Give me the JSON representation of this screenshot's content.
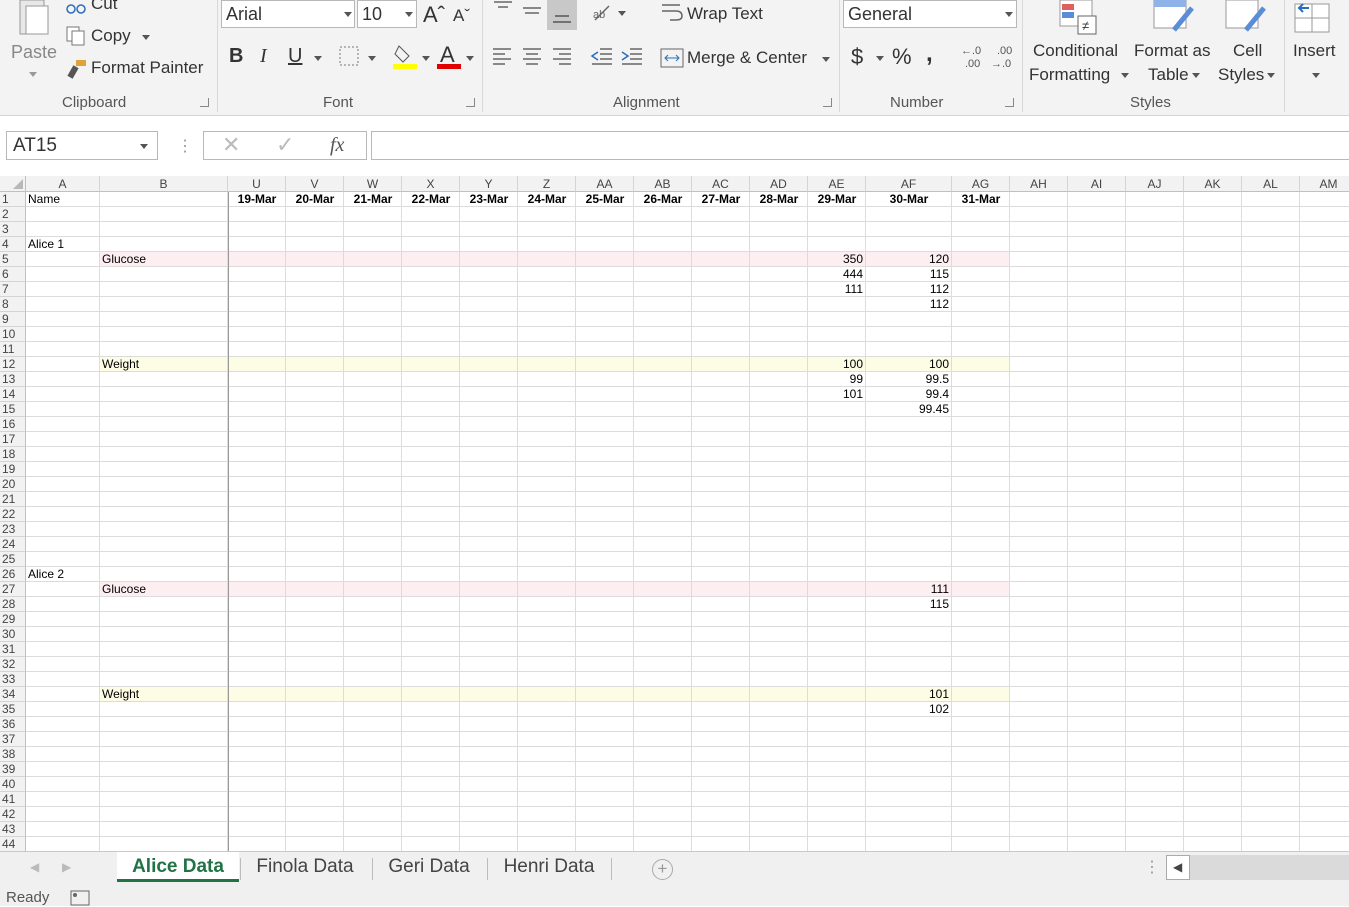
{
  "ribbon": {
    "clipboard": {
      "label": "Clipboard",
      "paste": "Paste",
      "cut": "Cut",
      "copy": "Copy",
      "format_painter": "Format Painter"
    },
    "font": {
      "label": "Font",
      "font_name": "Arial",
      "font_size": "10",
      "bold": "B",
      "italic": "I",
      "underline": "U"
    },
    "alignment": {
      "label": "Alignment",
      "wrap_text": "Wrap Text",
      "merge_center": "Merge & Center"
    },
    "number": {
      "label": "Number",
      "format": "General",
      "currency": "$",
      "percent": "%",
      "comma": ","
    },
    "styles": {
      "label": "Styles",
      "conditional": "Conditional",
      "conditional2": "Formatting",
      "format_as": "Format as",
      "format_as2": "Table",
      "cell": "Cell",
      "cell2": "Styles"
    },
    "cells": {
      "insert": "Insert"
    }
  },
  "formula_bar": {
    "name_box": "AT15",
    "fx": "fx",
    "formula": ""
  },
  "columns": [
    "A",
    "B",
    "U",
    "V",
    "W",
    "X",
    "Y",
    "Z",
    "AA",
    "AB",
    "AC",
    "AD",
    "AE",
    "AF",
    "AG",
    "AH",
    "AI",
    "AJ",
    "AK",
    "AL",
    "AM"
  ],
  "rows": [
    "1",
    "2",
    "3",
    "4",
    "5",
    "6",
    "7",
    "8",
    "9",
    "10",
    "11",
    "12",
    "13",
    "14",
    "15",
    "16",
    "17",
    "18",
    "19",
    "20",
    "21",
    "22",
    "23",
    "24",
    "25",
    "26",
    "27",
    "28",
    "29",
    "30",
    "31",
    "32",
    "33",
    "34",
    "35",
    "36",
    "37",
    "38",
    "39",
    "40",
    "41",
    "42",
    "43",
    "44"
  ],
  "header_row": {
    "A": "Name",
    "U": "19-Mar",
    "V": "20-Mar",
    "W": "21-Mar",
    "X": "22-Mar",
    "Y": "23-Mar",
    "Z": "24-Mar",
    "AA": "25-Mar",
    "AB": "26-Mar",
    "AC": "27-Mar",
    "AD": "28-Mar",
    "AE": "29-Mar",
    "AF": "30-Mar",
    "AG": "31-Mar"
  },
  "cells": [
    {
      "row": 4,
      "col": "A",
      "value": "Alice 1"
    },
    {
      "row": 5,
      "col": "B",
      "value": "Glucose"
    },
    {
      "row": 5,
      "col": "AE",
      "value": "350"
    },
    {
      "row": 5,
      "col": "AF",
      "value": "120"
    },
    {
      "row": 6,
      "col": "AE",
      "value": "444"
    },
    {
      "row": 6,
      "col": "AF",
      "value": "115"
    },
    {
      "row": 7,
      "col": "AE",
      "value": "111"
    },
    {
      "row": 7,
      "col": "AF",
      "value": "112"
    },
    {
      "row": 8,
      "col": "AF",
      "value": "112"
    },
    {
      "row": 12,
      "col": "B",
      "value": "Weight"
    },
    {
      "row": 12,
      "col": "AE",
      "value": "100"
    },
    {
      "row": 12,
      "col": "AF",
      "value": "100"
    },
    {
      "row": 13,
      "col": "AE",
      "value": "99"
    },
    {
      "row": 13,
      "col": "AF",
      "value": "99.5"
    },
    {
      "row": 14,
      "col": "AE",
      "value": "101"
    },
    {
      "row": 14,
      "col": "AF",
      "value": "99.4"
    },
    {
      "row": 15,
      "col": "AF",
      "value": "99.45"
    },
    {
      "row": 26,
      "col": "A",
      "value": "Alice 2"
    },
    {
      "row": 27,
      "col": "B",
      "value": "Glucose"
    },
    {
      "row": 27,
      "col": "AF",
      "value": "111"
    },
    {
      "row": 28,
      "col": "AF",
      "value": "115"
    },
    {
      "row": 34,
      "col": "B",
      "value": "Weight"
    },
    {
      "row": 34,
      "col": "AF",
      "value": "101"
    },
    {
      "row": 35,
      "col": "AF",
      "value": "102"
    }
  ],
  "highlight_rows": [
    {
      "row": 5,
      "color": "#fdeef2"
    },
    {
      "row": 12,
      "color": "#fdfde6"
    },
    {
      "row": 27,
      "color": "#fdeef2"
    },
    {
      "row": 34,
      "color": "#fdfde6"
    }
  ],
  "sheet_tabs": [
    {
      "label": "Alice Data",
      "active": true
    },
    {
      "label": "Finola Data",
      "active": false
    },
    {
      "label": "Geri Data",
      "active": false
    },
    {
      "label": "Henri Data",
      "active": false
    }
  ],
  "status": {
    "text": "Ready"
  },
  "colors": {
    "accent": "#217346",
    "font_red": "#e00000",
    "fill_yellow": "#ffff00"
  }
}
